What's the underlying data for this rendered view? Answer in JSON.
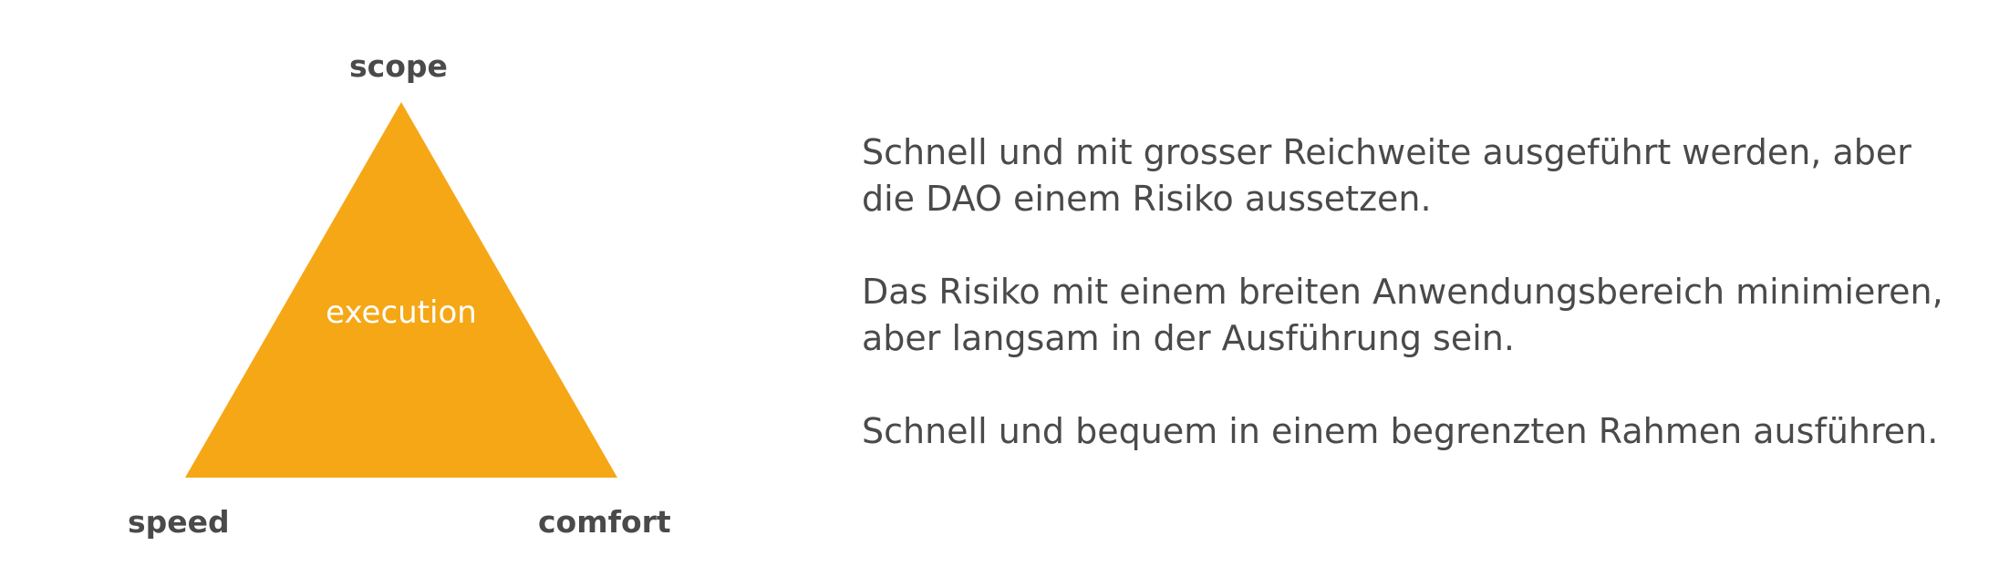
{
  "diagram": {
    "fill_color": "#F6A716",
    "text_color": "#4A4A4A",
    "labels": {
      "top": "scope",
      "left": "speed",
      "right": "comfort",
      "center": "execution"
    }
  },
  "text": {
    "paragraphs": [
      {
        "lines": [
          "Schnell und mit grosser Reichweite ausgeführt werden, aber",
          "die DAO einem Risiko aussetzen."
        ]
      },
      {
        "lines": [
          "Das Risiko mit einem breiten Anwendungsbereich minimieren,",
          "aber langsam in der Ausführung sein."
        ]
      },
      {
        "lines": [
          "Schnell und bequem in einem begrenzten Rahmen ausführen."
        ]
      }
    ]
  }
}
